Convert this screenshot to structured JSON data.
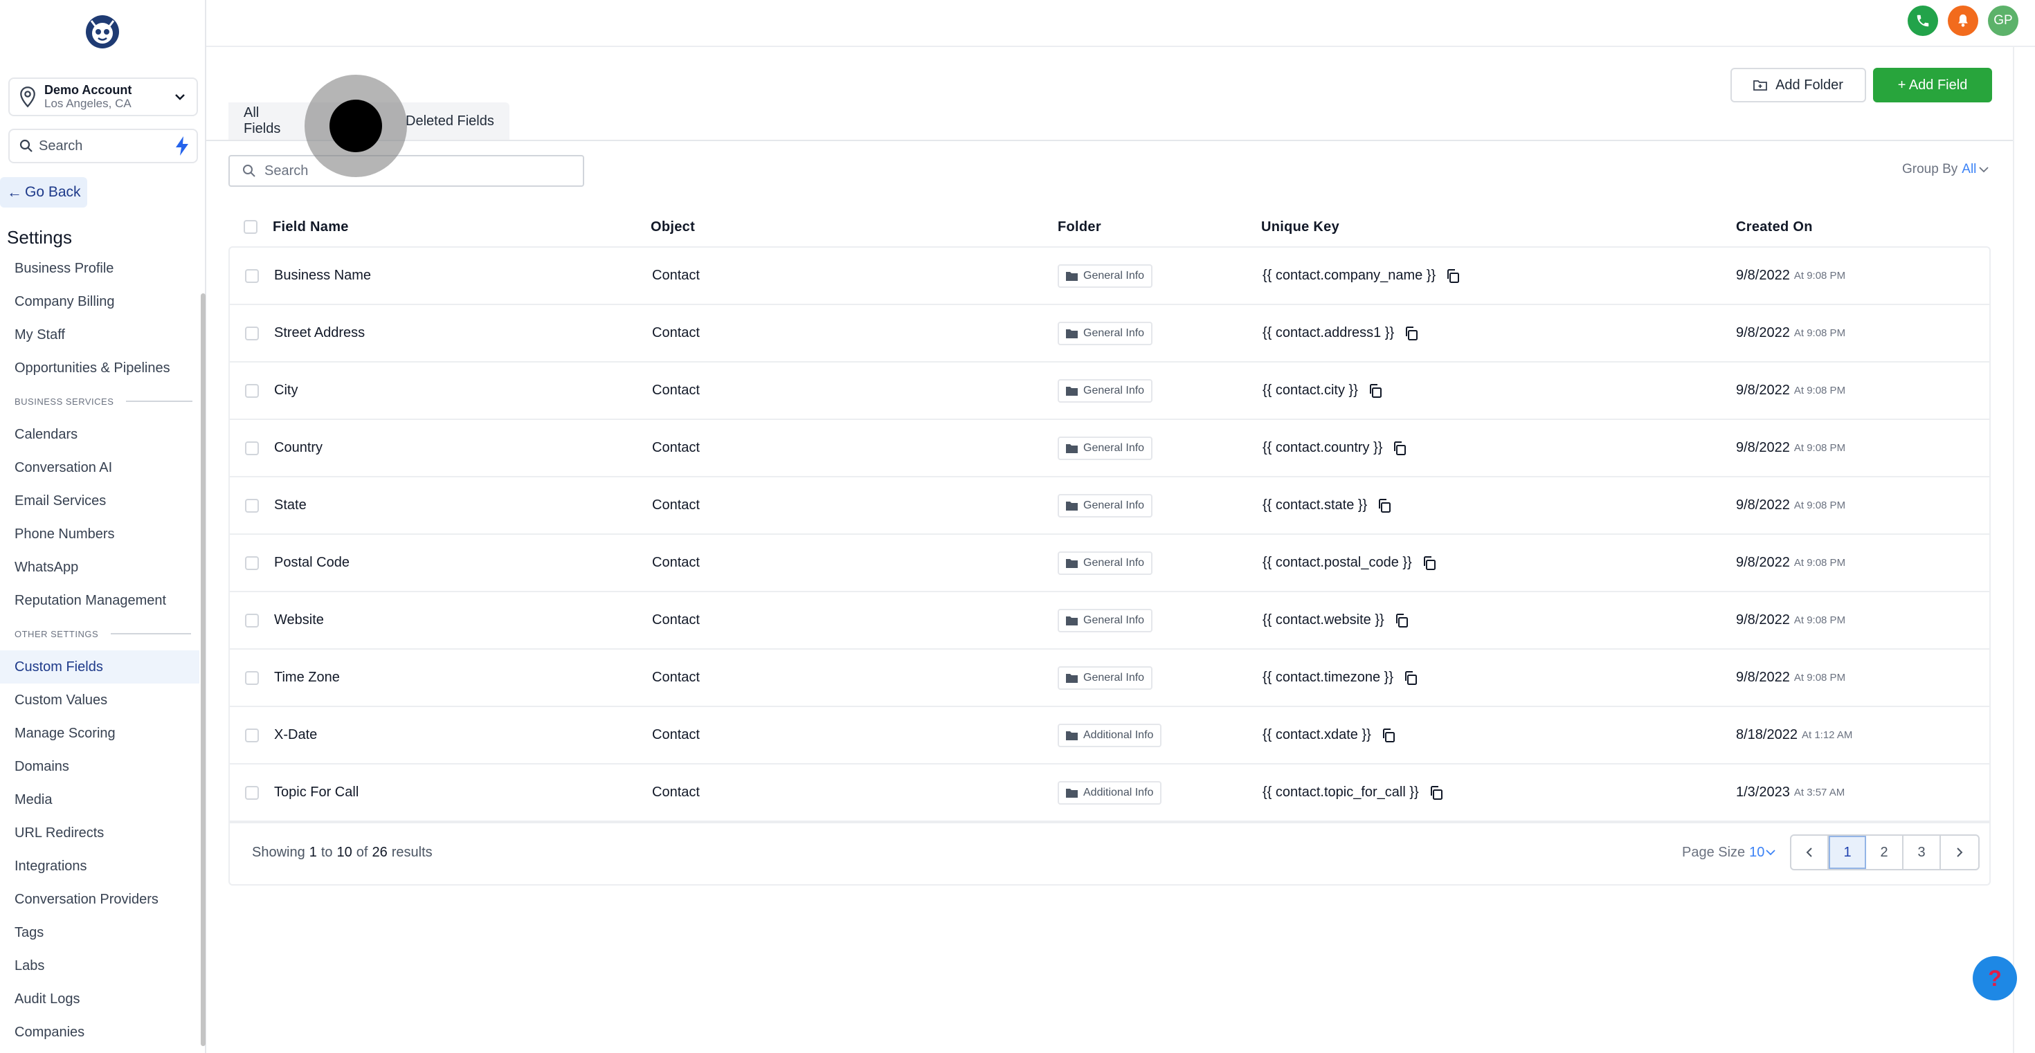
{
  "colors": {
    "accent_green": "#28a53c",
    "link_blue": "#3b82f6",
    "nav_active_bg": "#eef4fc",
    "phone_green": "#22a34a",
    "bell_orange": "#f26b1d",
    "avatar_green": "#5cb26a",
    "help_blue": "#1e88e5"
  },
  "sidebar": {
    "account": {
      "name": "Demo Account",
      "location": "Los Angeles, CA"
    },
    "search_label": "Search",
    "go_back": "Go Back",
    "settings_title": "Settings",
    "items": [
      {
        "label": "Business Profile"
      },
      {
        "label": "Company Billing"
      },
      {
        "label": "My Staff"
      },
      {
        "label": "Opportunities & Pipelines"
      }
    ],
    "section_business": "BUSINESS SERVICES",
    "business_items": [
      {
        "label": "Calendars"
      },
      {
        "label": "Conversation AI"
      },
      {
        "label": "Email Services"
      },
      {
        "label": "Phone Numbers"
      },
      {
        "label": "WhatsApp"
      },
      {
        "label": "Reputation Management"
      }
    ],
    "section_other": "OTHER SETTINGS",
    "other_items": [
      {
        "label": "Custom Fields",
        "active": true
      },
      {
        "label": "Custom Values"
      },
      {
        "label": "Manage Scoring"
      },
      {
        "label": "Domains"
      },
      {
        "label": "Media"
      },
      {
        "label": "URL Redirects"
      },
      {
        "label": "Integrations"
      },
      {
        "label": "Conversation Providers"
      },
      {
        "label": "Tags"
      },
      {
        "label": "Labs"
      },
      {
        "label": "Audit Logs"
      },
      {
        "label": "Companies"
      }
    ]
  },
  "topbar": {
    "avatar_initials": "GP"
  },
  "toolbar": {
    "add_folder": "Add Folder",
    "add_field": "+ Add Field"
  },
  "tabs": [
    {
      "label": "All Fields",
      "active": true
    },
    {
      "label": ""
    },
    {
      "label": "Deleted Fields"
    }
  ],
  "search": {
    "placeholder": "Search"
  },
  "group_by": {
    "label": "Group By",
    "value": "All"
  },
  "table": {
    "headers": {
      "field_name": "Field Name",
      "object": "Object",
      "folder": "Folder",
      "unique_key": "Unique Key",
      "created_on": "Created On"
    },
    "rows": [
      {
        "name": "Business Name",
        "object": "Contact",
        "folder": "General Info",
        "key": "{{ contact.company_name }}",
        "date": "9/8/2022",
        "time": "At 9:08 PM"
      },
      {
        "name": "Street Address",
        "object": "Contact",
        "folder": "General Info",
        "key": "{{ contact.address1 }}",
        "date": "9/8/2022",
        "time": "At 9:08 PM"
      },
      {
        "name": "City",
        "object": "Contact",
        "folder": "General Info",
        "key": "{{ contact.city }}",
        "date": "9/8/2022",
        "time": "At 9:08 PM"
      },
      {
        "name": "Country",
        "object": "Contact",
        "folder": "General Info",
        "key": "{{ contact.country }}",
        "date": "9/8/2022",
        "time": "At 9:08 PM"
      },
      {
        "name": "State",
        "object": "Contact",
        "folder": "General Info",
        "key": "{{ contact.state }}",
        "date": "9/8/2022",
        "time": "At 9:08 PM"
      },
      {
        "name": "Postal Code",
        "object": "Contact",
        "folder": "General Info",
        "key": "{{ contact.postal_code }}",
        "date": "9/8/2022",
        "time": "At 9:08 PM"
      },
      {
        "name": "Website",
        "object": "Contact",
        "folder": "General Info",
        "key": "{{ contact.website }}",
        "date": "9/8/2022",
        "time": "At 9:08 PM"
      },
      {
        "name": "Time Zone",
        "object": "Contact",
        "folder": "General Info",
        "key": "{{ contact.timezone }}",
        "date": "9/8/2022",
        "time": "At 9:08 PM"
      },
      {
        "name": "X-Date",
        "object": "Contact",
        "folder": "Additional Info",
        "key": "{{ contact.xdate }}",
        "date": "8/18/2022",
        "time": "At 1:12 AM"
      },
      {
        "name": "Topic For Call",
        "object": "Contact",
        "folder": "Additional Info",
        "key": "{{ contact.topic_for_call }}",
        "date": "1/3/2023",
        "time": "At 3:57 AM"
      }
    ]
  },
  "footer": {
    "showing_prefix": "Showing",
    "from": "1",
    "to_word": "to",
    "to": "10",
    "of_word": "of",
    "total": "26",
    "results_word": "results",
    "page_size_label": "Page Size",
    "page_size_value": "10",
    "pages": [
      "1",
      "2",
      "3"
    ],
    "current_page": "1"
  }
}
